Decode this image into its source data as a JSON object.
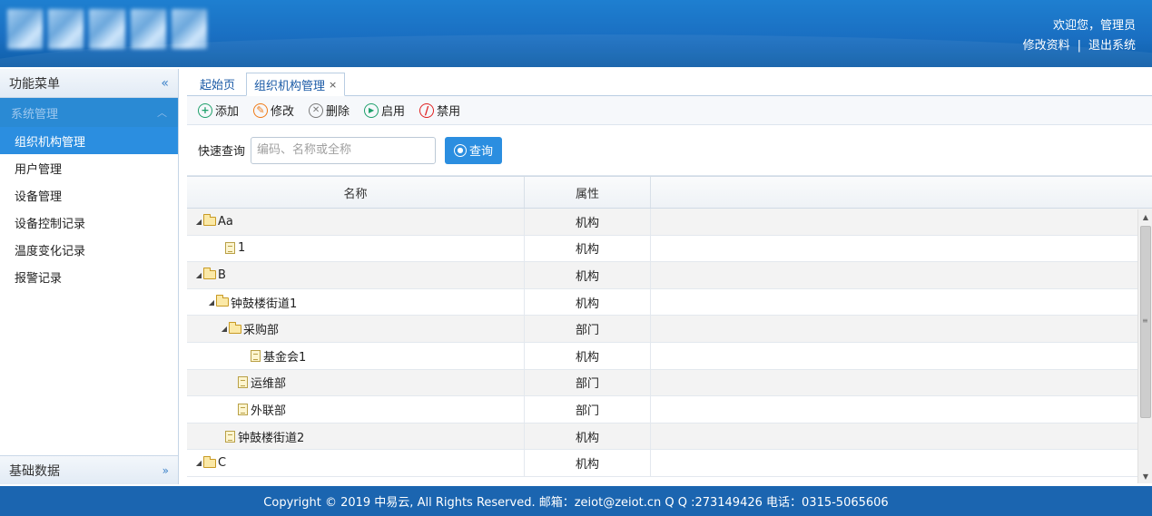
{
  "header": {
    "welcome": "欢迎您，管理员",
    "edit_profile": "修改资料",
    "separator": "|",
    "logout": "退出系统"
  },
  "sidebar": {
    "title": "功能菜单",
    "collapse_glyph": "«",
    "group": "系统管理",
    "items": [
      {
        "label": "组织机构管理",
        "active": true
      },
      {
        "label": "用户管理"
      },
      {
        "label": "设备管理"
      },
      {
        "label": "设备控制记录"
      },
      {
        "label": "温度变化记录"
      },
      {
        "label": "报警记录"
      }
    ],
    "bottom_group": "基础数据"
  },
  "tabs": [
    {
      "label": "起始页"
    },
    {
      "label": "组织机构管理",
      "close": "×",
      "active": true
    }
  ],
  "toolbar": {
    "add": "添加",
    "edit": "修改",
    "delete": "删除",
    "enable": "启用",
    "disable": "禁用"
  },
  "search": {
    "label": "快速查询",
    "placeholder": "编码、名称或全称",
    "button": "查询"
  },
  "grid": {
    "columns": [
      "名称",
      "属性"
    ],
    "rows": [
      {
        "name": "Aa",
        "attr": "机构",
        "type": "folder",
        "level": 0,
        "expanded": true
      },
      {
        "name": "1",
        "attr": "机构",
        "type": "file",
        "level": 1
      },
      {
        "name": "B",
        "attr": "机构",
        "type": "folder",
        "level": 0,
        "expanded": true
      },
      {
        "name": "钟鼓楼街道1",
        "attr": "机构",
        "type": "folder",
        "level": 1,
        "expanded": true
      },
      {
        "name": "采购部",
        "attr": "部门",
        "type": "folder",
        "level": 2,
        "expanded": true
      },
      {
        "name": "基金会1",
        "attr": "机构",
        "type": "file",
        "level": 3
      },
      {
        "name": "运维部",
        "attr": "部门",
        "type": "file",
        "level": 2
      },
      {
        "name": "外联部",
        "attr": "部门",
        "type": "file",
        "level": 2
      },
      {
        "name": "钟鼓楼街道2",
        "attr": "机构",
        "type": "file",
        "level": 1
      },
      {
        "name": "C",
        "attr": "机构",
        "type": "folder",
        "level": 0,
        "expanded": true
      }
    ]
  },
  "footer": {
    "text": "Copyright © 2019 中易云, All Rights Reserved. 邮箱：zeiot@zeiot.cn Q Q :273149426 电话：0315-5065606"
  },
  "colors": {
    "primary": "#2b8ee0",
    "header": "#1a6fc2",
    "footer": "#1b65b0",
    "add_icon": "#1ea06b",
    "edit_icon": "#f07a16",
    "disable_icon": "#e02020"
  }
}
